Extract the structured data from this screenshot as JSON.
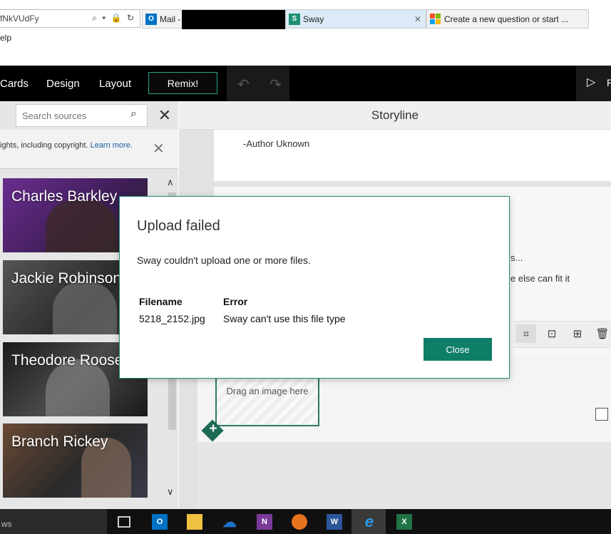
{
  "browser": {
    "address_fragment": "fNkVUdFy",
    "address_icons": "⌕ ▾ 🔒 ↻",
    "tabs": [
      {
        "icon_name": "outlook-icon",
        "icon_color": "#0072c6",
        "label": "Mail -"
      },
      {
        "icon_name": "sway-icon",
        "icon_color": "#1e8f70",
        "label": "Sway",
        "close": "✕"
      },
      {
        "icon_name": "microsoft-logo-icon",
        "icon_color": "#f25022",
        "label": "Create a new question or start ..."
      }
    ],
    "menu_fragment": "elp"
  },
  "toolbar": {
    "items": [
      "Cards",
      "Design",
      "Layout"
    ],
    "remix_label": "Remix!",
    "undo_icon": "↶",
    "redo_icon": "↷",
    "play_icon": "▷",
    "play_label": "P"
  },
  "left_panel": {
    "search_placeholder": "Search sources",
    "search_icon": "⌕",
    "close_icon": "✕",
    "copyright_text": "ights, including copyright.",
    "copyright_link": "Learn more.",
    "copyright_close": "✕",
    "cards": [
      {
        "name": "Charles Barkley",
        "bg": "#5a2a7a"
      },
      {
        "name": "Jackie Robinson",
        "bg": "#3a3a3a"
      },
      {
        "name": "Theodore Roosevelt",
        "bg": "#2b2b2b"
      },
      {
        "name": "Branch Rickey",
        "bg": "#5a3a25"
      }
    ],
    "scroll_up": "∧",
    "scroll_down": "∨"
  },
  "storyline": {
    "title": "Storyline",
    "author": "-Author Uknown",
    "partial_text_1": "s...",
    "partial_text_2": "e else can fit it",
    "drop_text": "Drag an image here",
    "add_icon": "+",
    "image_tools": [
      "⌗",
      "⊡",
      "⊞",
      "🗑"
    ]
  },
  "dialog": {
    "title": "Upload failed",
    "message": "Sway couldn't upload one or more files.",
    "col_filename": "Filename",
    "col_error": "Error",
    "filename": "5218_2152.jpg",
    "error": "Sway can't use this file type",
    "close_label": "Close"
  },
  "taskbar": {
    "search_fragment": "ws",
    "apps": [
      {
        "name": "task-view-icon",
        "color": "#101010",
        "glyph": "▭"
      },
      {
        "name": "outlook-icon",
        "color": "#0072c6",
        "glyph": "O"
      },
      {
        "name": "file-explorer-icon",
        "color": "#f0c040",
        "glyph": ""
      },
      {
        "name": "onedrive-icon",
        "color": "#1e6fc7",
        "glyph": "☁"
      },
      {
        "name": "onenote-icon",
        "color": "#7a3a9a",
        "glyph": "N"
      },
      {
        "name": "firefox-icon",
        "color": "#e8731e",
        "glyph": ""
      },
      {
        "name": "word-icon",
        "color": "#2b579a",
        "glyph": "W"
      },
      {
        "name": "internet-explorer-icon",
        "color": "#1e88e5",
        "glyph": "e"
      },
      {
        "name": "excel-icon",
        "color": "#217346",
        "glyph": "X"
      }
    ]
  }
}
